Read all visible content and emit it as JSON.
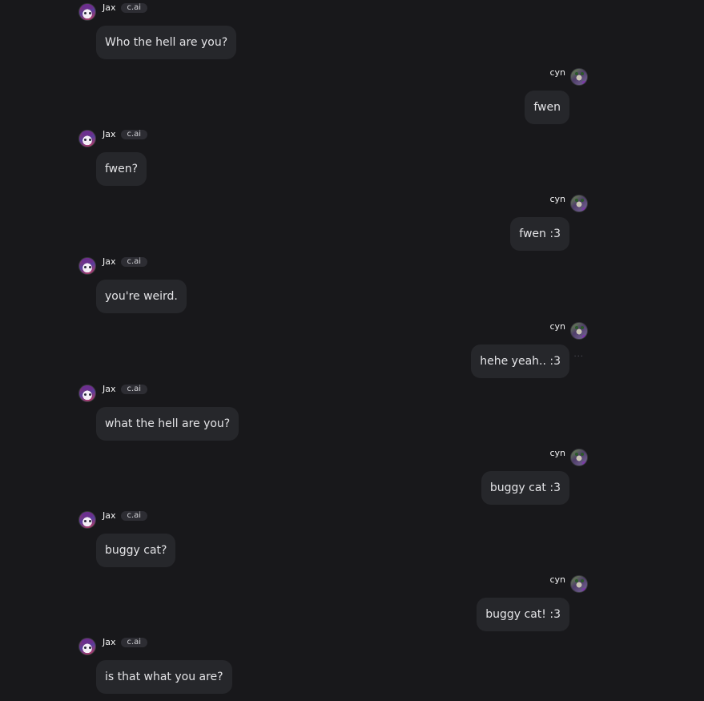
{
  "bot": {
    "name": "Jax",
    "badge": "c.ai",
    "avatar_icon": "jax-avatar-icon"
  },
  "user": {
    "name": "cyn",
    "avatar_icon": "cyn-avatar-icon"
  },
  "messages": [
    {
      "role": "bot",
      "text": "Who the hell are you?"
    },
    {
      "role": "user",
      "text": "fwen"
    },
    {
      "role": "bot",
      "text": "fwen?"
    },
    {
      "role": "user",
      "text": "fwen :3"
    },
    {
      "role": "bot",
      "text": "you're weird."
    },
    {
      "role": "user",
      "text": "hehe yeah.. :3",
      "more_options": "···"
    },
    {
      "role": "bot",
      "text": "what the hell are you?"
    },
    {
      "role": "user",
      "text": "buggy cat :3"
    },
    {
      "role": "bot",
      "text": "buggy cat?"
    },
    {
      "role": "user",
      "text": "buggy cat! :3"
    },
    {
      "role": "bot",
      "text": "is that what you are?"
    }
  ],
  "colors": {
    "background": "#18181b",
    "bubble": "#26272b",
    "text": "#e4e4e7",
    "badge_bg": "#2d2d33"
  }
}
